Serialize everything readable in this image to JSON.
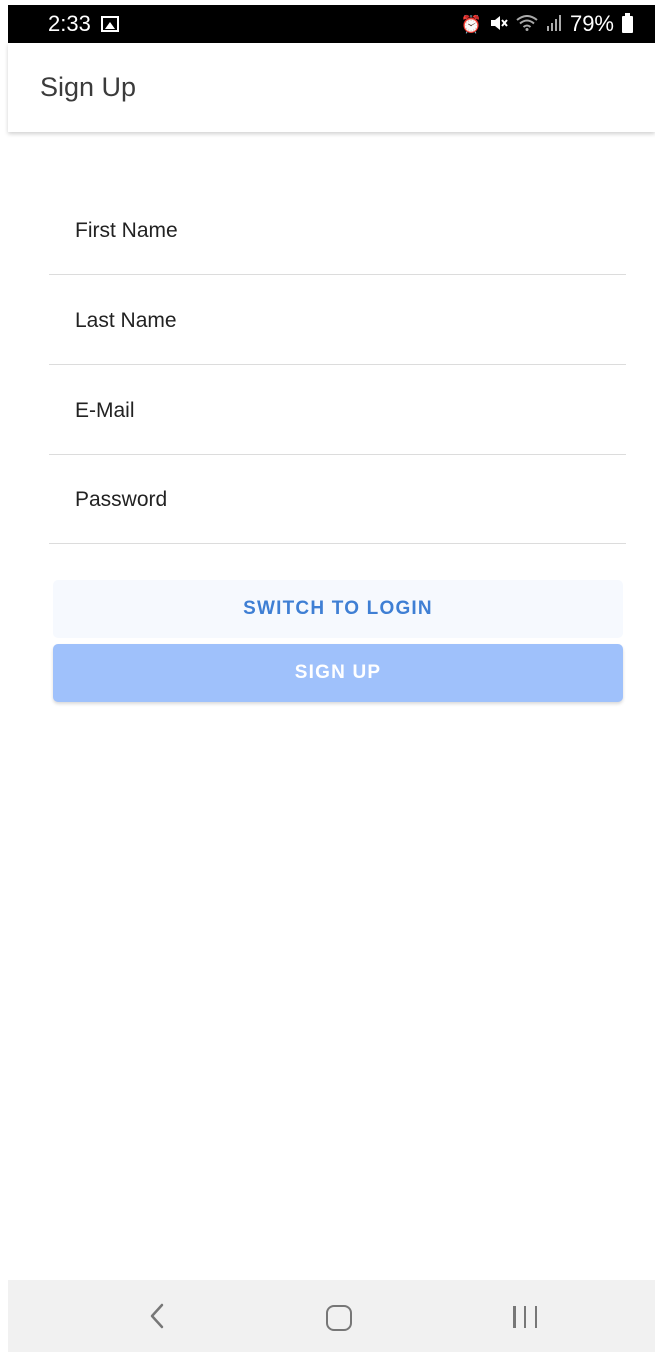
{
  "status_bar": {
    "time": "2:33",
    "battery_percent": "79%",
    "icons": [
      "gallery-icon",
      "alarm-icon",
      "mute-icon",
      "wifi-icon",
      "signal-icon",
      "battery-icon"
    ]
  },
  "app_bar": {
    "title": "Sign Up"
  },
  "form": {
    "first_name_placeholder": "First Name",
    "last_name_placeholder": "Last Name",
    "email_placeholder": "E-Mail",
    "password_placeholder": "Password"
  },
  "buttons": {
    "switch_label": "SWITCH TO LOGIN",
    "signup_label": "SIGN UP"
  },
  "colors": {
    "accent": "#3f7fd4",
    "signup_button_bg": "#9fc1fb",
    "switch_button_bg": "#f6f9fe"
  },
  "nav_bar": {
    "icons": [
      "back-icon",
      "home-icon",
      "recents-icon"
    ]
  }
}
